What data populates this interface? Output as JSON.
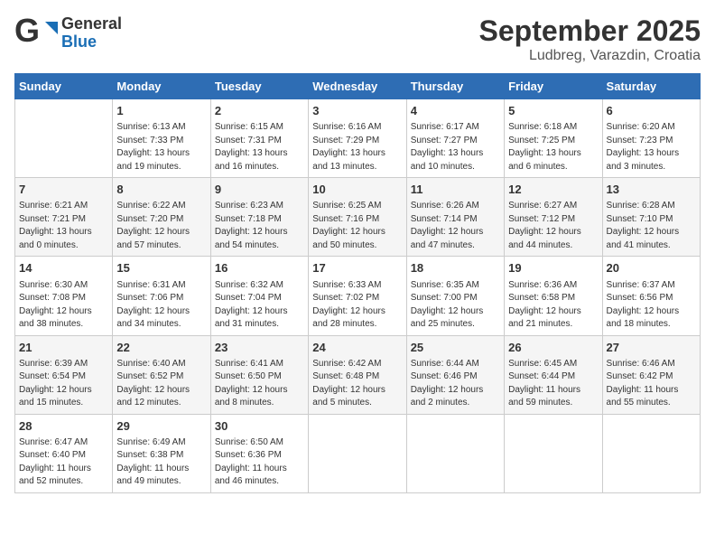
{
  "header": {
    "logo_line1": "General",
    "logo_line2": "Blue",
    "month": "September 2025",
    "location": "Ludbreg, Varazdin, Croatia"
  },
  "days_of_week": [
    "Sunday",
    "Monday",
    "Tuesday",
    "Wednesday",
    "Thursday",
    "Friday",
    "Saturday"
  ],
  "weeks": [
    [
      {
        "day": "",
        "info": ""
      },
      {
        "day": "1",
        "info": "Sunrise: 6:13 AM\nSunset: 7:33 PM\nDaylight: 13 hours\nand 19 minutes."
      },
      {
        "day": "2",
        "info": "Sunrise: 6:15 AM\nSunset: 7:31 PM\nDaylight: 13 hours\nand 16 minutes."
      },
      {
        "day": "3",
        "info": "Sunrise: 6:16 AM\nSunset: 7:29 PM\nDaylight: 13 hours\nand 13 minutes."
      },
      {
        "day": "4",
        "info": "Sunrise: 6:17 AM\nSunset: 7:27 PM\nDaylight: 13 hours\nand 10 minutes."
      },
      {
        "day": "5",
        "info": "Sunrise: 6:18 AM\nSunset: 7:25 PM\nDaylight: 13 hours\nand 6 minutes."
      },
      {
        "day": "6",
        "info": "Sunrise: 6:20 AM\nSunset: 7:23 PM\nDaylight: 13 hours\nand 3 minutes."
      }
    ],
    [
      {
        "day": "7",
        "info": "Sunrise: 6:21 AM\nSunset: 7:21 PM\nDaylight: 13 hours\nand 0 minutes."
      },
      {
        "day": "8",
        "info": "Sunrise: 6:22 AM\nSunset: 7:20 PM\nDaylight: 12 hours\nand 57 minutes."
      },
      {
        "day": "9",
        "info": "Sunrise: 6:23 AM\nSunset: 7:18 PM\nDaylight: 12 hours\nand 54 minutes."
      },
      {
        "day": "10",
        "info": "Sunrise: 6:25 AM\nSunset: 7:16 PM\nDaylight: 12 hours\nand 50 minutes."
      },
      {
        "day": "11",
        "info": "Sunrise: 6:26 AM\nSunset: 7:14 PM\nDaylight: 12 hours\nand 47 minutes."
      },
      {
        "day": "12",
        "info": "Sunrise: 6:27 AM\nSunset: 7:12 PM\nDaylight: 12 hours\nand 44 minutes."
      },
      {
        "day": "13",
        "info": "Sunrise: 6:28 AM\nSunset: 7:10 PM\nDaylight: 12 hours\nand 41 minutes."
      }
    ],
    [
      {
        "day": "14",
        "info": "Sunrise: 6:30 AM\nSunset: 7:08 PM\nDaylight: 12 hours\nand 38 minutes."
      },
      {
        "day": "15",
        "info": "Sunrise: 6:31 AM\nSunset: 7:06 PM\nDaylight: 12 hours\nand 34 minutes."
      },
      {
        "day": "16",
        "info": "Sunrise: 6:32 AM\nSunset: 7:04 PM\nDaylight: 12 hours\nand 31 minutes."
      },
      {
        "day": "17",
        "info": "Sunrise: 6:33 AM\nSunset: 7:02 PM\nDaylight: 12 hours\nand 28 minutes."
      },
      {
        "day": "18",
        "info": "Sunrise: 6:35 AM\nSunset: 7:00 PM\nDaylight: 12 hours\nand 25 minutes."
      },
      {
        "day": "19",
        "info": "Sunrise: 6:36 AM\nSunset: 6:58 PM\nDaylight: 12 hours\nand 21 minutes."
      },
      {
        "day": "20",
        "info": "Sunrise: 6:37 AM\nSunset: 6:56 PM\nDaylight: 12 hours\nand 18 minutes."
      }
    ],
    [
      {
        "day": "21",
        "info": "Sunrise: 6:39 AM\nSunset: 6:54 PM\nDaylight: 12 hours\nand 15 minutes."
      },
      {
        "day": "22",
        "info": "Sunrise: 6:40 AM\nSunset: 6:52 PM\nDaylight: 12 hours\nand 12 minutes."
      },
      {
        "day": "23",
        "info": "Sunrise: 6:41 AM\nSunset: 6:50 PM\nDaylight: 12 hours\nand 8 minutes."
      },
      {
        "day": "24",
        "info": "Sunrise: 6:42 AM\nSunset: 6:48 PM\nDaylight: 12 hours\nand 5 minutes."
      },
      {
        "day": "25",
        "info": "Sunrise: 6:44 AM\nSunset: 6:46 PM\nDaylight: 12 hours\nand 2 minutes."
      },
      {
        "day": "26",
        "info": "Sunrise: 6:45 AM\nSunset: 6:44 PM\nDaylight: 11 hours\nand 59 minutes."
      },
      {
        "day": "27",
        "info": "Sunrise: 6:46 AM\nSunset: 6:42 PM\nDaylight: 11 hours\nand 55 minutes."
      }
    ],
    [
      {
        "day": "28",
        "info": "Sunrise: 6:47 AM\nSunset: 6:40 PM\nDaylight: 11 hours\nand 52 minutes."
      },
      {
        "day": "29",
        "info": "Sunrise: 6:49 AM\nSunset: 6:38 PM\nDaylight: 11 hours\nand 49 minutes."
      },
      {
        "day": "30",
        "info": "Sunrise: 6:50 AM\nSunset: 6:36 PM\nDaylight: 11 hours\nand 46 minutes."
      },
      {
        "day": "",
        "info": ""
      },
      {
        "day": "",
        "info": ""
      },
      {
        "day": "",
        "info": ""
      },
      {
        "day": "",
        "info": ""
      }
    ]
  ]
}
